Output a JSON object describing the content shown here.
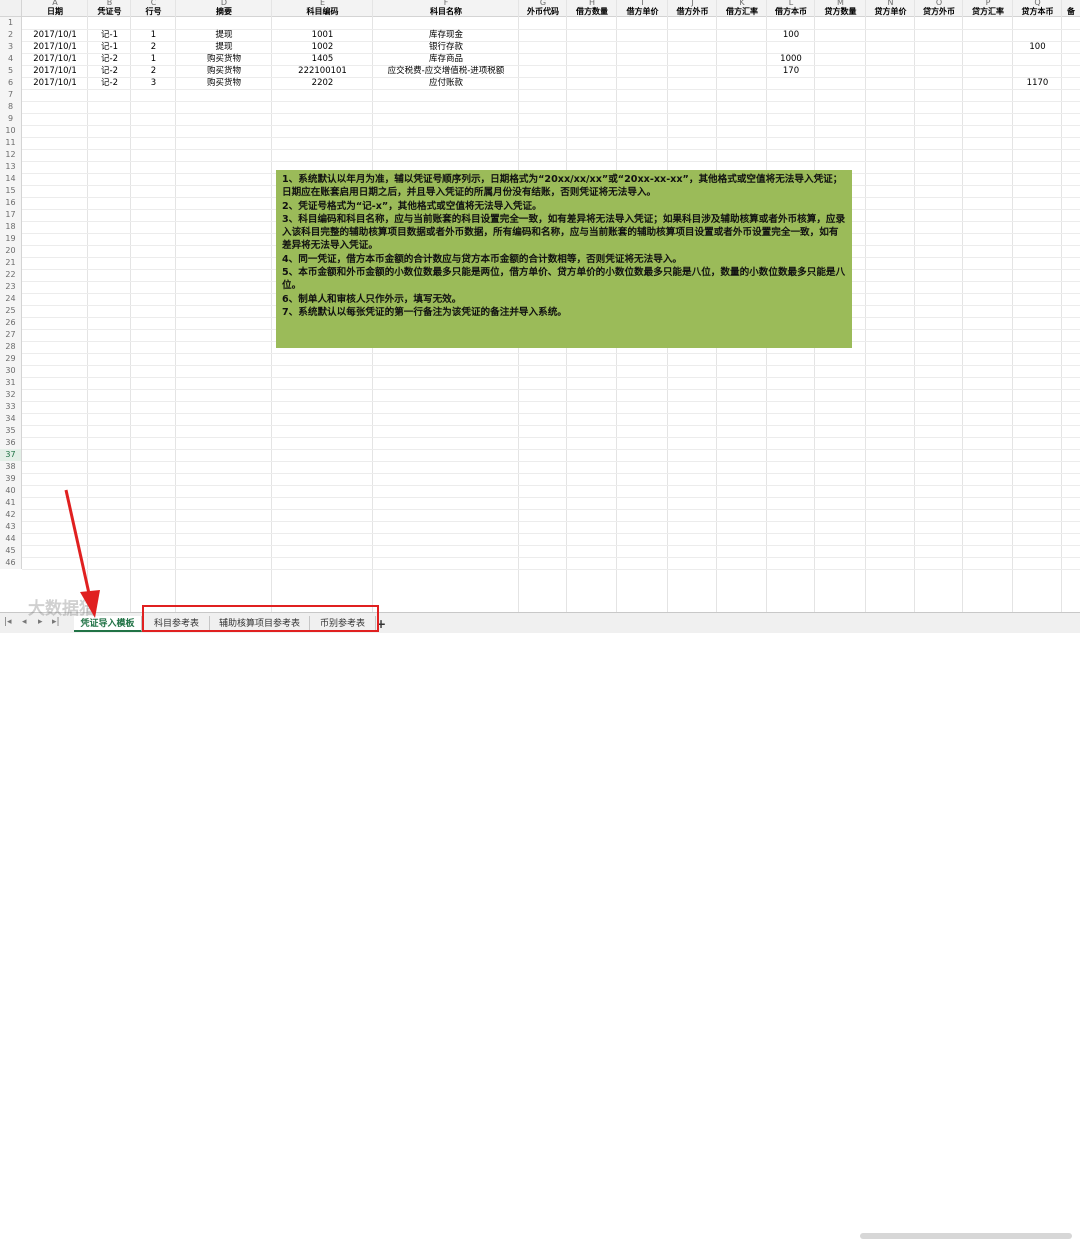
{
  "columns": [
    {
      "letter": "A",
      "name": "日期"
    },
    {
      "letter": "B",
      "name": "凭证号"
    },
    {
      "letter": "C",
      "name": "行号"
    },
    {
      "letter": "D",
      "name": "摘要"
    },
    {
      "letter": "E",
      "name": "科目编码"
    },
    {
      "letter": "F",
      "name": "科目名称"
    },
    {
      "letter": "G",
      "name": "外币代码"
    },
    {
      "letter": "H",
      "name": "借方数量"
    },
    {
      "letter": "I",
      "name": "借方单价"
    },
    {
      "letter": "J",
      "name": "借方外币"
    },
    {
      "letter": "K",
      "name": "借方汇率"
    },
    {
      "letter": "L",
      "name": "借方本币"
    },
    {
      "letter": "M",
      "name": "贷方数量"
    },
    {
      "letter": "N",
      "name": "贷方单价"
    },
    {
      "letter": "O",
      "name": "贷方外币"
    },
    {
      "letter": "P",
      "name": "贷方汇率"
    },
    {
      "letter": "Q",
      "name": "贷方本币"
    },
    {
      "letter": "",
      "name": "备"
    }
  ],
  "rows": [
    [
      "2017/10/1",
      "记-1",
      "1",
      "提现",
      "1001",
      "库存现金",
      "",
      "",
      "",
      "",
      "",
      "100",
      "",
      "",
      "",
      "",
      ""
    ],
    [
      "2017/10/1",
      "记-1",
      "2",
      "提现",
      "1002",
      "银行存款",
      "",
      "",
      "",
      "",
      "",
      "",
      "",
      "",
      "",
      "",
      "100"
    ],
    [
      "2017/10/1",
      "记-2",
      "1",
      "购买货物",
      "1405",
      "库存商品",
      "",
      "",
      "",
      "",
      "",
      "1000",
      "",
      "",
      "",
      "",
      ""
    ],
    [
      "2017/10/1",
      "记-2",
      "2",
      "购买货物",
      "222100101",
      "应交税费-应交增值税-进项税额",
      "",
      "",
      "",
      "",
      "",
      "170",
      "",
      "",
      "",
      "",
      ""
    ],
    [
      "2017/10/1",
      "记-2",
      "3",
      "购买货物",
      "2202",
      "应付账款",
      "",
      "",
      "",
      "",
      "",
      "",
      "",
      "",
      "",
      "",
      "1170"
    ]
  ],
  "row_numbers": [
    "1",
    "2",
    "3",
    "4",
    "5",
    "6",
    "7",
    "8",
    "9",
    "10",
    "11",
    "12",
    "13",
    "14",
    "15",
    "16",
    "17",
    "18",
    "19",
    "20",
    "21",
    "22",
    "23",
    "24",
    "25",
    "26",
    "27",
    "28",
    "29",
    "30",
    "31",
    "32",
    "33",
    "34",
    "35",
    "36",
    "37",
    "38",
    "39",
    "40",
    "41",
    "42",
    "43",
    "44",
    "45",
    "46"
  ],
  "selected_row": "37",
  "note": [
    "1、系统默认以年月为准，辅以凭证号顺序列示，日期格式为“20xx/xx/xx”或“20xx-xx-xx”，其他格式或空值将无法导入凭证；日期应在账套启用日期之后，并且导入凭证的所属月份没有结账，否则凭证将无法导入。",
    "2、凭证号格式为“记-x”，其他格式或空值将无法导入凭证。",
    "3、科目编码和科目名称，应与当前账套的科目设置完全一致，如有差异将无法导入凭证；如果科目涉及辅助核算或者外币核算，应录入该科目完整的辅助核算项目数据或者外币数据，所有编码和名称，应与当前账套的辅助核算项目设置或者外币设置完全一致，如有差异将无法导入凭证。",
    "4、同一凭证，借方本币金额的合计数应与贷方本币金额的合计数相等，否则凭证将无法导入。",
    "5、本币金额和外币金额的小数位数最多只能是两位，借方单价、贷方单价的小数位数最多只能是八位，数量的小数位数最多只能是八位。",
    "6、制单人和审核人只作外示，填写无效。",
    "7、系统默认以每张凭证的第一行备注为该凭证的备注并导入系统。"
  ],
  "tabs": {
    "active": "凭证导入模板",
    "others": [
      "科目参考表",
      "辅助核算项目参考表",
      "币别参考表"
    ],
    "add_label": "+"
  },
  "nav_icons": [
    "first-sheet-icon",
    "prev-sheet-icon",
    "next-sheet-icon",
    "last-sheet-icon"
  ],
  "watermark": "大数据猎",
  "colors": {
    "note_bg": "#9bbb59",
    "accent": "#217346",
    "annotation": "#e02020"
  }
}
